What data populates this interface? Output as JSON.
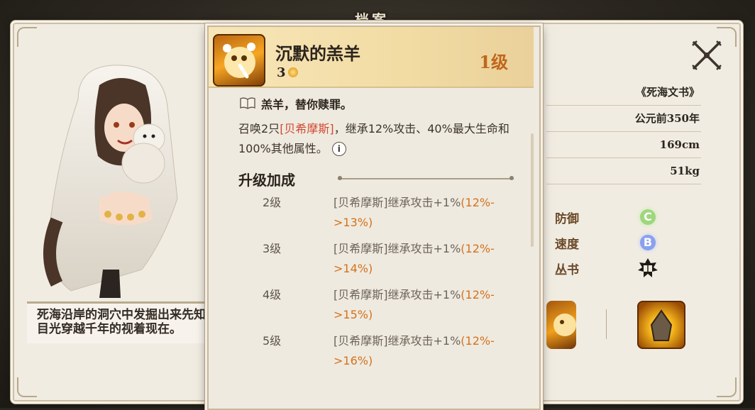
{
  "window": {
    "title": "档案"
  },
  "character": {
    "story": "死海沿岸的洞穴中发掘出来先知的目光穿越千年的视着现在。",
    "info": [
      {
        "key": "source",
        "value": "《死海文书》"
      },
      {
        "key": "era",
        "value": "公元前350年"
      },
      {
        "key": "height",
        "value": "169cm"
      },
      {
        "key": "weight",
        "value": "51kg"
      }
    ],
    "stats": [
      {
        "label": "防御",
        "grade": "C"
      },
      {
        "label": "速度",
        "grade": "B"
      },
      {
        "label": "丛书",
        "icon": "book-emblem-icon"
      }
    ]
  },
  "skill": {
    "name": "沉默的羔羊",
    "cost": "3",
    "level": "1级",
    "flavor": "羔羊，替你赎罪。",
    "desc_prefix": "召唤2只",
    "desc_summon": "[贝希摩斯]",
    "desc_suffix": "，继承12%攻击、40%最大生命和100%其他属性。",
    "info_glyph": "i",
    "upgrade_title": "升级加成",
    "upgrades": [
      {
        "level": "2级",
        "text": "[贝希摩斯]继承攻击+1%",
        "change": "(12%->13%)"
      },
      {
        "level": "3级",
        "text": "[贝希摩斯]继承攻击+1%",
        "change": "(12%->14%)"
      },
      {
        "level": "4级",
        "text": "[贝希摩斯]继承攻击+1%",
        "change": "(12%->15%)"
      },
      {
        "level": "5级",
        "text": "[贝希摩斯]继承攻击+1%",
        "change": "(12%->16%)"
      }
    ]
  },
  "colors": {
    "accent": "#c0661b",
    "summon": "#d14a33",
    "upgrade_value": "#d2721f"
  }
}
